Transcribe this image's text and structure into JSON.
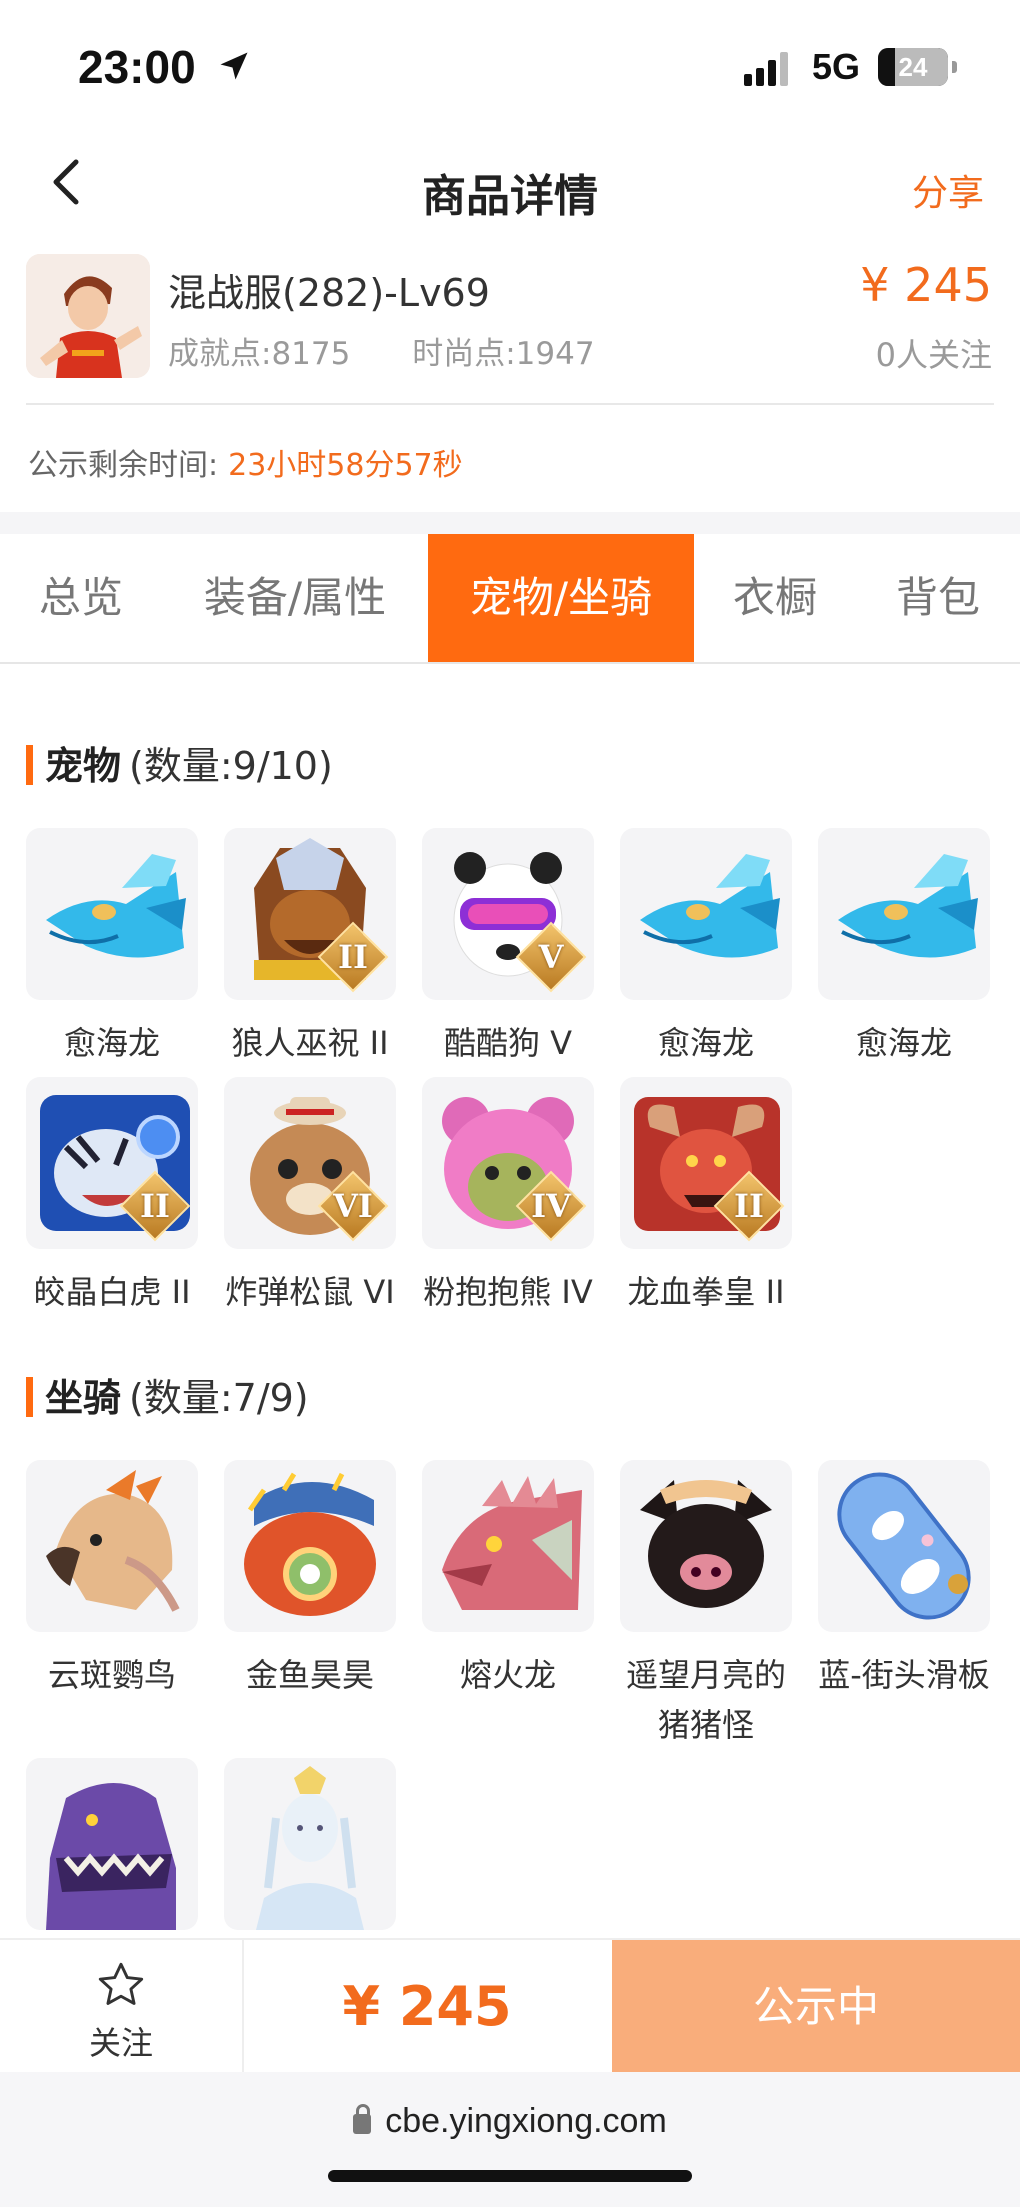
{
  "status_bar": {
    "time": "23:00",
    "network": "5G",
    "battery": "24",
    "battery_level": 0.24
  },
  "nav": {
    "title": "商品详情",
    "share": "分享"
  },
  "product": {
    "name": "混战服(282)-Lv69",
    "achievement": "成就点:8175",
    "fashion": "时尚点:1947",
    "price": "¥ 245",
    "followers": "0人关注"
  },
  "countdown": {
    "label": "公示剩余时间:",
    "value": "23小时58分57秒"
  },
  "tabs": [
    "总览",
    "装备/属性",
    "宠物/坐骑",
    "衣橱",
    "背包"
  ],
  "active_tab": "宠物/坐骑",
  "pets": {
    "title": "宠物",
    "count": "(数量:9/10)",
    "items": [
      {
        "name": "愈海龙",
        "icon": "blue-ice-dragon-icon",
        "rank": ""
      },
      {
        "name": "狼人巫祝 II",
        "icon": "werewolf-shaman-icon",
        "rank": "II"
      },
      {
        "name": "酷酷狗 V",
        "icon": "cool-dog-goggles-icon",
        "rank": "V"
      },
      {
        "name": "愈海龙",
        "icon": "blue-ice-dragon-icon",
        "rank": ""
      },
      {
        "name": "愈海龙",
        "icon": "blue-ice-dragon-icon",
        "rank": ""
      },
      {
        "name": "皎晶白虎 II",
        "icon": "crystal-white-tiger-icon",
        "rank": "II"
      },
      {
        "name": "炸弹松鼠 VI",
        "icon": "bomb-squirrel-icon",
        "rank": "VI"
      },
      {
        "name": "粉抱抱熊 IV",
        "icon": "pink-hug-bear-icon",
        "rank": "IV"
      },
      {
        "name": "龙血拳皇 II",
        "icon": "dragon-blood-fighter-icon",
        "rank": "II"
      }
    ]
  },
  "mounts": {
    "title": "坐骑",
    "count": "(数量:7/9)",
    "items": [
      {
        "name": "云斑鹦鸟",
        "icon": "cloud-parrot-icon"
      },
      {
        "name": "金鱼昊昊",
        "icon": "goldfish-icon"
      },
      {
        "name": "熔火龙",
        "icon": "lava-dragon-icon"
      },
      {
        "name": "遥望月亮的猪猪怪",
        "icon": "moon-pig-monster-icon"
      },
      {
        "name": "蓝-街头滑板",
        "icon": "blue-skateboard-icon"
      },
      {
        "name": "",
        "icon": "purple-dinosaur-icon"
      },
      {
        "name": "",
        "icon": "moon-fairy-icon"
      }
    ]
  },
  "bottom": {
    "follow": "关注",
    "price": "¥ 245",
    "action": "公示中"
  },
  "url": "cbe.yingxiong.com",
  "colors": {
    "accent": "#ff6a10",
    "price": "#f26b1d",
    "action_bg": "#f9ad7b"
  }
}
